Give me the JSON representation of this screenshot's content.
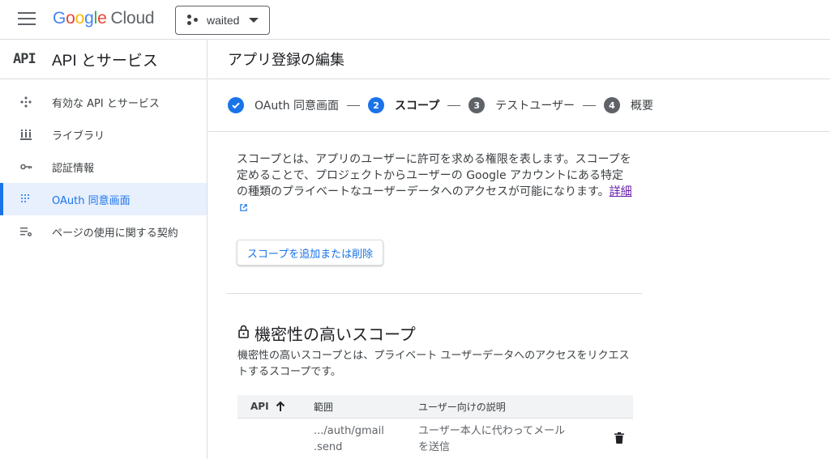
{
  "topbar": {
    "logo_letters": [
      "G",
      "o",
      "o",
      "g",
      "l",
      "e"
    ],
    "logo_suffix": "Cloud",
    "project_name": "waited"
  },
  "sidebar": {
    "badge": "API",
    "title": "API とサービス",
    "items": [
      {
        "label": "有効な API とサービス",
        "icon": "apis-icon",
        "active": false
      },
      {
        "label": "ライブラリ",
        "icon": "library-icon",
        "active": false
      },
      {
        "label": "認証情報",
        "icon": "key-icon",
        "active": false
      },
      {
        "label": "OAuth 同意画面",
        "icon": "oauth-consent-icon",
        "active": true
      },
      {
        "label": "ページの使用に関する契約",
        "icon": "agreements-icon",
        "active": false
      }
    ]
  },
  "main": {
    "page_title": "アプリ登録の編集",
    "steps": [
      {
        "label": "OAuth 同意画面",
        "state": "done"
      },
      {
        "number": "2",
        "label": "スコープ",
        "state": "current"
      },
      {
        "number": "3",
        "label": "テストユーザー",
        "state": "pending"
      },
      {
        "number": "4",
        "label": "概要",
        "state": "pending"
      }
    ],
    "description": "スコープとは、アプリのユーザーに許可を求める権限を表します。スコープを定めることで、プロジェクトからユーザーの Google アカウントにある特定の種類のプライベートなユーザーデータへのアクセスが可能になります。",
    "learn_more": "詳細",
    "add_remove_button": "スコープを追加または削除",
    "sensitive": {
      "title": "機密性の高いスコープ",
      "description": "機密性の高いスコープとは、プライベート ユーザーデータへのアクセスをリクエストするスコープです。",
      "columns": [
        "API",
        "範囲",
        "ユーザー向けの説明"
      ],
      "rows": [
        {
          "api": "",
          "scope_line1": ".../auth/gmail",
          "scope_line2": ".send",
          "desc_line1": "ユーザー本人に代わってメール",
          "desc_line2": "を送信"
        }
      ]
    }
  },
  "colors": {
    "accent": "#1a73e8",
    "visited_link": "#681da8",
    "active_nav_bg": "#e8f0fe"
  }
}
